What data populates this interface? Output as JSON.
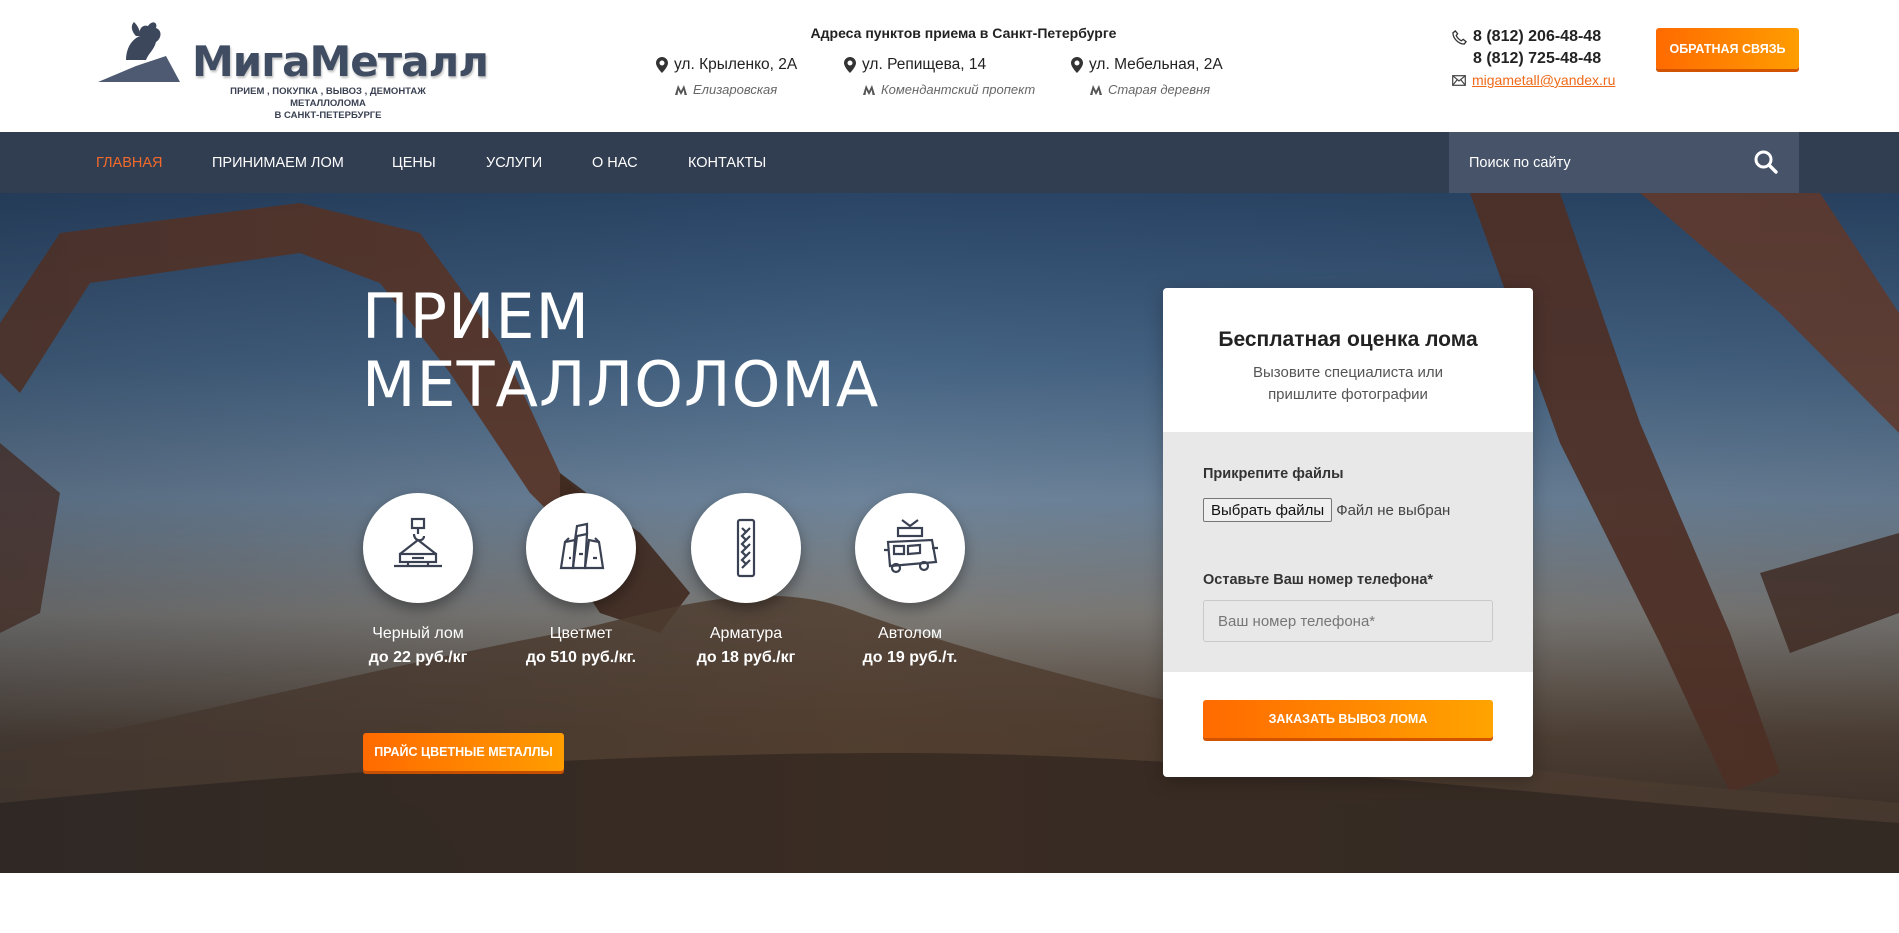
{
  "brand": {
    "name": "МигаМеталл",
    "tagline_line1": "ПРИЕМ , ПОКУПКА , ВЫВОЗ , ДЕМОНТАЖ МЕТАЛЛОЛОМА",
    "tagline_line2": "В САНКТ-ПЕТЕРБУРГЕ",
    "logo_icon": "bronze-horseman-icon"
  },
  "addresses": {
    "title": "Адреса пунктов приема в Санкт-Петербурге",
    "items": [
      {
        "street": "ул. Крыленко, 2А",
        "metro": "Елизаровская"
      },
      {
        "street": "ул. Репищева, 14",
        "metro": "Комендантский пропект"
      },
      {
        "street": "ул. Мебельная, 2А",
        "metro": "Старая деревня"
      }
    ]
  },
  "contacts": {
    "phone1": "8 (812) 206-48-48",
    "phone2": "8 (812) 725-48-48",
    "email": "migametall@yandex.ru",
    "feedback_button": "ОБРАТНАЯ СВЯЗЬ"
  },
  "nav": {
    "items": [
      "ГЛАВНАЯ",
      "ПРИНИМАЕМ ЛОМ",
      "ЦЕНЫ",
      "УСЛУГИ",
      "О НАС",
      "КОНТАКТЫ"
    ],
    "active": "ГЛАВНАЯ",
    "search_placeholder": "Поиск по сайту"
  },
  "hero": {
    "title_line1": "ПРИЕМ",
    "title_line2": "МЕТАЛЛОЛОМА",
    "categories": [
      {
        "name": "Черный лом",
        "price": "до 22 руб./кг",
        "icon": "crane-hook-icon"
      },
      {
        "name": "Цветмет",
        "price": "до 510 руб./кг.",
        "icon": "metal-ingots-icon"
      },
      {
        "name": "Арматура",
        "price": "до 18 руб./кг",
        "icon": "rebar-icon"
      },
      {
        "name": "Автолом",
        "price": "до 19 руб./т.",
        "icon": "car-scrap-icon"
      }
    ],
    "price_button": "ПРАЙС ЦВЕТНЫЕ МЕТАЛЛЫ"
  },
  "form": {
    "title": "Бесплатная оценка лома",
    "subtitle_line1": "Вызовите специалиста или",
    "subtitle_line2": "пришлите фотографии",
    "attach_label": "Прикрепите файлы",
    "file_button": "Выбрать файлы",
    "file_status": "Файл не выбран",
    "phone_label": "Оставьте Ваш номер телефона*",
    "phone_placeholder": "Ваш номер телефона*",
    "submit_button": "ЗАКАЗАТЬ ВЫВОЗ ЛОМА"
  },
  "colors": {
    "accent_orange": "#ff7a00",
    "nav_bg": "#313d51",
    "search_bg": "#465369",
    "active_nav": "#f26a2a"
  }
}
